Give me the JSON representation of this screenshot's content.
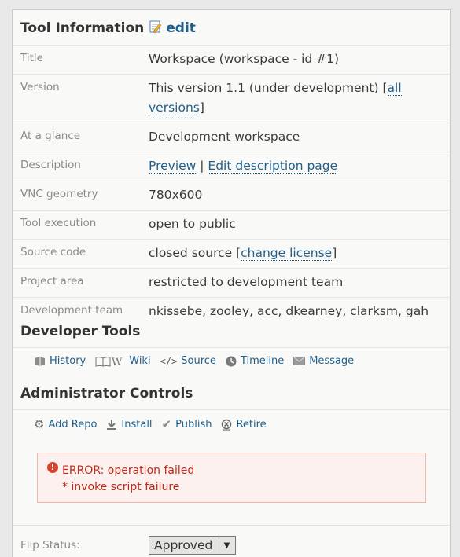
{
  "tool_info": {
    "title": "Tool Information",
    "edit_label": "edit",
    "rows": [
      {
        "label": "Title",
        "value": "Workspace (workspace - id #1)"
      },
      {
        "label": "Version",
        "value_text": "This version 1.1 (under development) [",
        "link": "all versions",
        "value_suffix": "]"
      },
      {
        "label": "At a glance",
        "value": "Development workspace"
      },
      {
        "label": "Description",
        "link1": "Preview",
        "separator": " | ",
        "link2": "Edit description page"
      },
      {
        "label": "VNC geometry",
        "value": "780x600"
      },
      {
        "label": "Tool execution",
        "value": "open to public"
      },
      {
        "label": "Source code",
        "value_text": "closed source [",
        "link": "change license",
        "value_suffix": "]"
      },
      {
        "label": "Project area",
        "value": "restricted to development team"
      },
      {
        "label": "Development team",
        "value": "nkissebe, zooley, acc, dkearney, clarksm, gah"
      }
    ]
  },
  "developer_tools": {
    "title": "Developer Tools",
    "items": [
      {
        "label": "History",
        "icon": "history-icon"
      },
      {
        "label": "Wiki",
        "icon": "wiki-icon"
      },
      {
        "label": "Source",
        "icon": "source-icon"
      },
      {
        "label": "Timeline",
        "icon": "timeline-icon"
      },
      {
        "label": "Message",
        "icon": "message-icon"
      }
    ]
  },
  "admin_controls": {
    "title": "Administrator Controls",
    "items": [
      {
        "label": "Add Repo",
        "icon": "gear-icon"
      },
      {
        "label": "Install",
        "icon": "install-icon"
      },
      {
        "label": "Publish",
        "icon": "checkmark-icon"
      },
      {
        "label": "Retire",
        "icon": "retire-icon"
      }
    ]
  },
  "error": {
    "line1": "ERROR: operation failed",
    "line2": "* invoke script failure"
  },
  "flip_status": {
    "label": "Flip Status:",
    "selected": "Approved"
  }
}
